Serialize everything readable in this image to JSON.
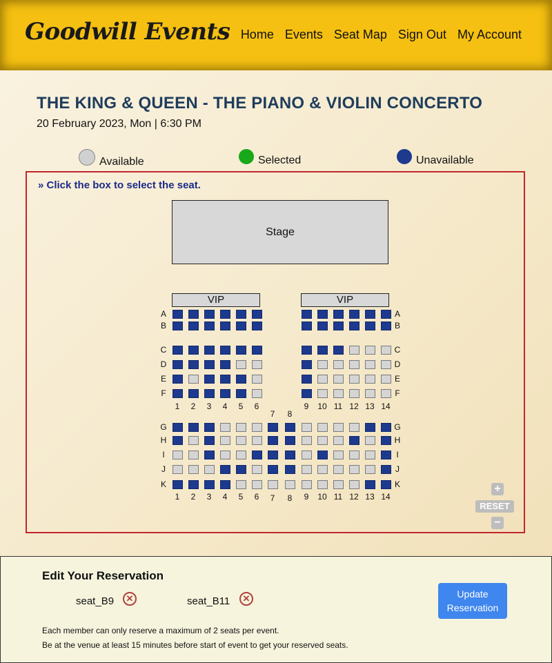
{
  "brand": "Goodwill Events",
  "nav": [
    "Home",
    "Events",
    "Seat Map",
    "Sign Out",
    "My Account"
  ],
  "event": {
    "title": "THE KING & QUEEN - THE PIANO & VIOLIN CONCERTO",
    "date": "20 February 2023, Mon | 6:30 PM"
  },
  "legend": [
    {
      "label": "Available",
      "color": "#d0d0d0"
    },
    {
      "label": "Selected",
      "color": "#19a819"
    },
    {
      "label": "Unavailable",
      "color": "#1d3a8f"
    }
  ],
  "map": {
    "instruction": "Click the box to select the seat.",
    "stage_label": "Stage",
    "vip_label": "VIP",
    "zoom_in": "+",
    "reset": "RESET",
    "zoom_out": "−",
    "col_labels": [
      "1",
      "2",
      "3",
      "4",
      "5",
      "6",
      "7",
      "8",
      "9",
      "10",
      "11",
      "12",
      "13",
      "14"
    ],
    "top_section": {
      "rows": [
        {
          "label": "A",
          "left": "UUUUUU",
          "right": "UUUUUU"
        },
        {
          "label": "B",
          "left": "UUUUUU",
          "right": "UUUUUU"
        },
        {
          "label": "C",
          "left": "UUUUUU",
          "right": "UUUAAA"
        },
        {
          "label": "D",
          "left": "UUUUAA",
          "right": "UAAAAA"
        },
        {
          "label": "E",
          "left": "UAUUUA",
          "right": "UAAAAA"
        },
        {
          "label": "F",
          "left": "UUUUUA",
          "right": "UAAAAA"
        }
      ]
    },
    "bottom_section": {
      "rows": [
        {
          "label": "G",
          "seats": "UUUAAAUUAAAAUU"
        },
        {
          "label": "H",
          "seats": "UAUAAAUUAAAUAU"
        },
        {
          "label": "I",
          "seats": "AAUAAUUUAUAAAU"
        },
        {
          "label": "J",
          "seats": "AAAUUAUUAAAAAU"
        },
        {
          "label": "K",
          "seats": "UUUUAAAAAAAAUU"
        }
      ]
    }
  },
  "reservation": {
    "title": "Edit Your Reservation",
    "seats": [
      "seat_B9",
      "seat_B11"
    ],
    "update_label_1": "Update",
    "update_label_2": "Reservation",
    "note_1": "Each member can only reserve a maximum of 2 seats per event.",
    "note_2": "Be at the venue at least 15 minutes before start of event to get your reserved seats."
  }
}
